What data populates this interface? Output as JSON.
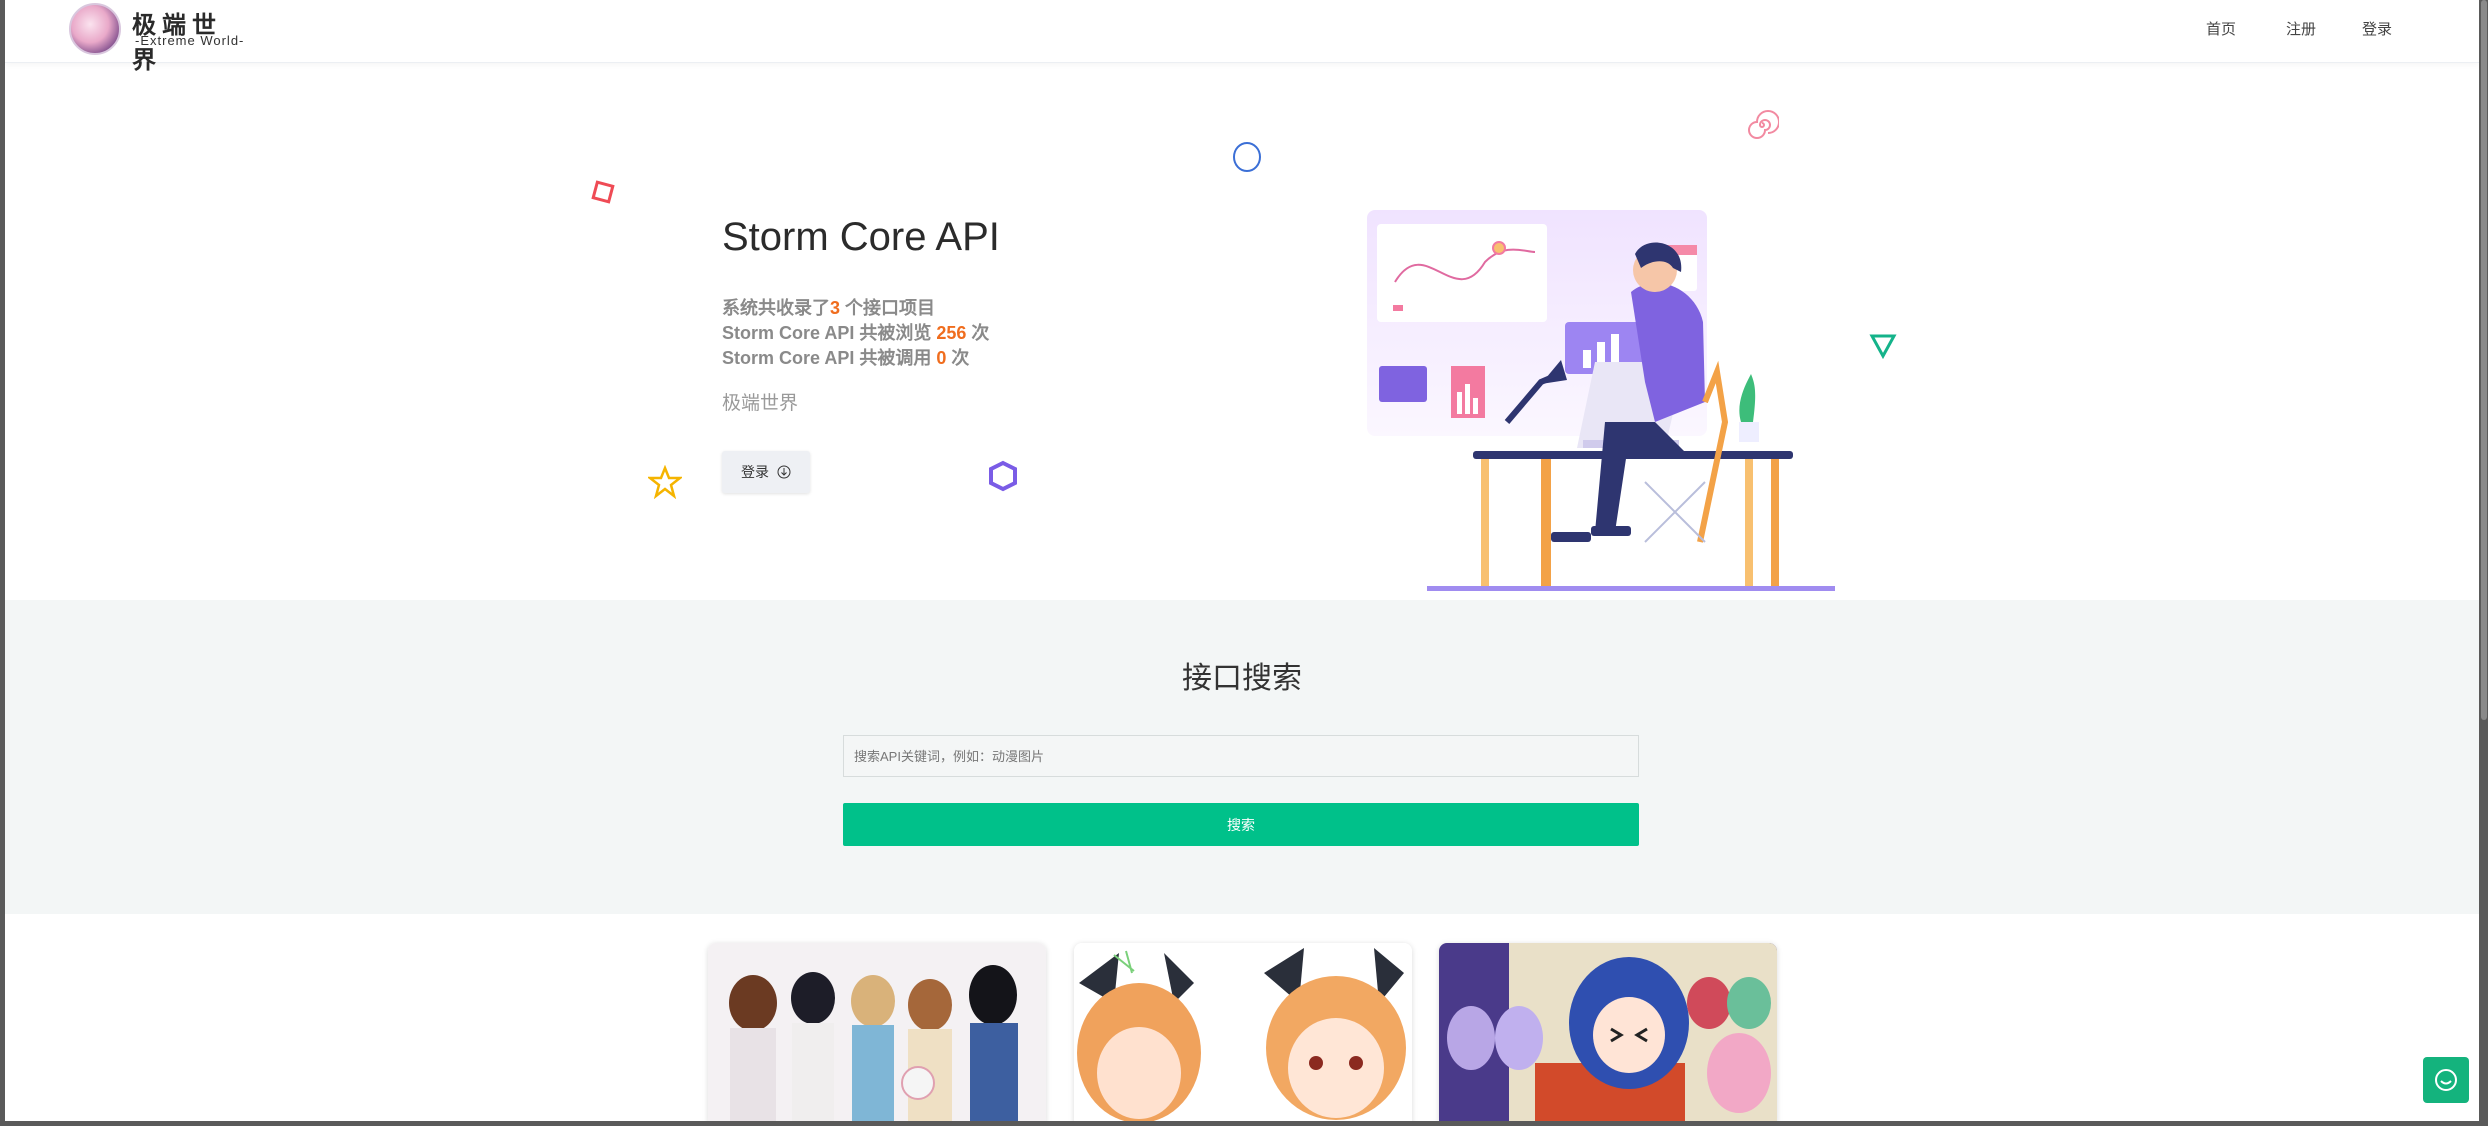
{
  "header": {
    "logo_title": "极端世界",
    "logo_subtitle": "-Extreme World-",
    "nav": {
      "home": "首页",
      "register": "注册",
      "login": "登录"
    }
  },
  "hero": {
    "title": "Storm Core API",
    "stats": {
      "line1_prefix": "系统共收录了",
      "line1_count": "3",
      "line1_suffix": " 个接口项目",
      "line2_prefix": "Storm Core API 共被浏览 ",
      "line2_count": "256",
      "line2_suffix": " 次",
      "line3_prefix": "Storm Core API 共被调用 ",
      "line3_count": "0",
      "line3_suffix": " 次"
    },
    "subtitle": "极端世界",
    "login_button": "登录"
  },
  "search": {
    "title": "接口搜索",
    "placeholder": "搜索API关键词，例如：动漫图片",
    "button": "搜索"
  },
  "colors": {
    "accent_green": "#00c18a",
    "stat_number": "#f06d1e",
    "nav_text": "#444444"
  },
  "icons": [
    "login-icon",
    "chat-icon"
  ]
}
